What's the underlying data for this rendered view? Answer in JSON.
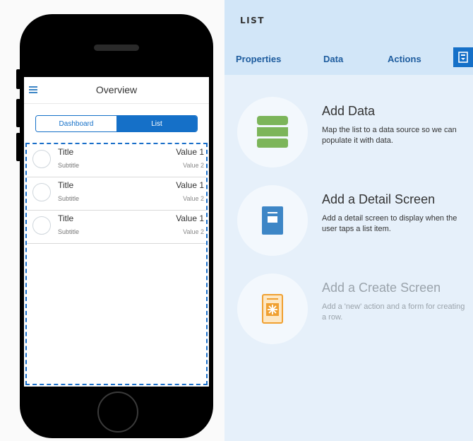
{
  "phone": {
    "screen_title": "Overview",
    "segments": [
      "Dashboard",
      "List"
    ],
    "selected_segment": "List",
    "rows": [
      {
        "title": "Title",
        "subtitle": "Subtitle",
        "value1": "Value 1",
        "value2": "Value 2"
      },
      {
        "title": "Title",
        "subtitle": "Subtitle",
        "value1": "Value 1",
        "value2": "Value 2"
      },
      {
        "title": "Title",
        "subtitle": "Subtitle",
        "value1": "Value 1",
        "value2": "Value 2"
      }
    ]
  },
  "panel": {
    "title": "LIST",
    "tabs": [
      "Properties",
      "Data",
      "Actions"
    ],
    "cards": [
      {
        "heading": "Add Data",
        "description": "Map the list to a data source so we can populate it with data.",
        "icon": "database-icon"
      },
      {
        "heading": "Add a Detail Screen",
        "description": "Add a detail screen to display when the user taps a list item.",
        "icon": "detail-screen-icon"
      },
      {
        "heading": "Add a Create Screen",
        "description": "Add a 'new' action and a form for creating a row.",
        "icon": "create-screen-icon"
      }
    ]
  },
  "colors": {
    "accent": "#1570c8",
    "panel_bg": "#e6f0fa",
    "database_green": "#7cb55a",
    "detail_blue": "#3d86c6",
    "create_orange": "#f0a030"
  }
}
